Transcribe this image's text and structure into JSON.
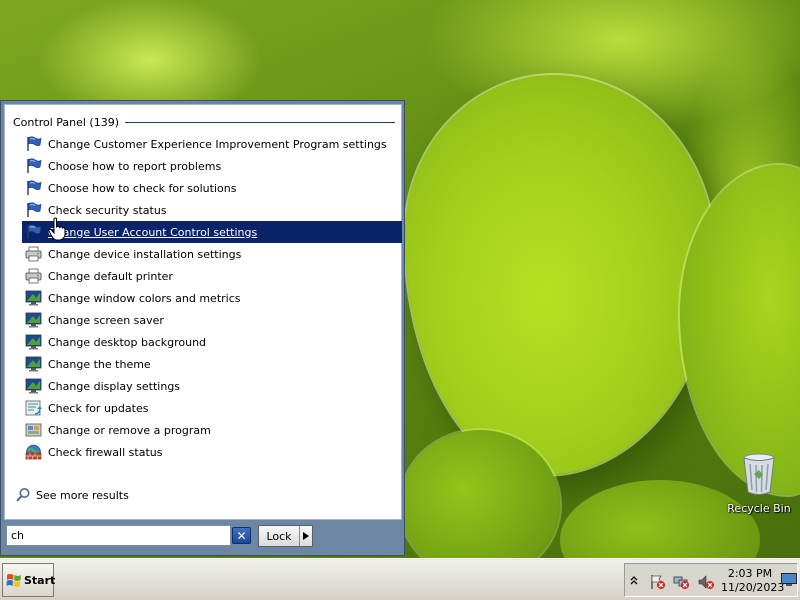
{
  "desktop": {
    "recycle_bin_label": "Recycle Bin"
  },
  "start_menu": {
    "group_title": "Control Panel (139)",
    "results": [
      {
        "label": "Change Customer Experience Improvement Program settings",
        "icon": "flag-icon"
      },
      {
        "label": "Choose how to report problems",
        "icon": "flag-icon"
      },
      {
        "label": "Choose how to check for solutions",
        "icon": "flag-icon"
      },
      {
        "label": "Check security status",
        "icon": "flag-icon"
      },
      {
        "label": "Change User Account Control settings",
        "icon": "flag-icon",
        "selected": true
      },
      {
        "label": "Change device installation settings",
        "icon": "printer-icon"
      },
      {
        "label": "Change default printer",
        "icon": "printer-icon"
      },
      {
        "label": "Change window colors and metrics",
        "icon": "monitor-icon"
      },
      {
        "label": "Change screen saver",
        "icon": "monitor-icon"
      },
      {
        "label": "Change desktop background",
        "icon": "monitor-icon"
      },
      {
        "label": "Change the theme",
        "icon": "monitor-icon"
      },
      {
        "label": "Change display settings",
        "icon": "monitor-icon"
      },
      {
        "label": "Check for updates",
        "icon": "update-icon"
      },
      {
        "label": "Change or remove a program",
        "icon": "programs-icon"
      },
      {
        "label": "Check firewall status",
        "icon": "firewall-icon"
      }
    ],
    "see_more": "See more results",
    "search_value": "ch",
    "lock_label": "Lock"
  },
  "taskbar": {
    "start_label": "Start",
    "time": "2:03 PM",
    "date": "11/20/2023"
  },
  "colors": {
    "selection": "#0a246a",
    "menu_frame": "#6c86a4",
    "taskbar": "#d4d0c8"
  }
}
